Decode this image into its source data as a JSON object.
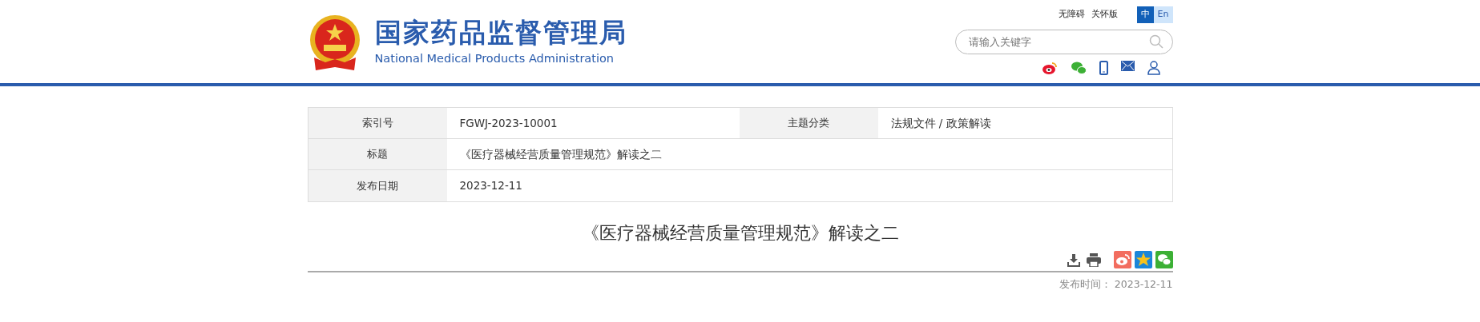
{
  "header": {
    "title": "国家药品监督管理局",
    "subtitle": "National Medical Products Administration",
    "links": [
      "无障碍",
      "关怀版"
    ],
    "languages": [
      {
        "label": "中",
        "selected": true
      },
      {
        "label": "En",
        "selected": false
      }
    ],
    "search": {
      "placeholder": "请输入关键字"
    },
    "share_icons": [
      {
        "kind": "weibo"
      },
      {
        "kind": "wechat"
      },
      {
        "kind": "phone"
      },
      {
        "kind": "mail"
      },
      {
        "kind": "user"
      }
    ]
  },
  "info_table": {
    "rows": [
      {
        "cells": [
          {
            "label": "索引号",
            "value": "FGWJ-2023-10001"
          },
          {
            "label": "主题分类",
            "value": "法规文件 / 政策解读"
          }
        ]
      },
      {
        "cells": [
          {
            "label": "标题",
            "value": "《医疗器械经营质量管理规范》解读之二"
          }
        ]
      },
      {
        "cells": [
          {
            "label": "发布日期",
            "value": "2023-12-11"
          }
        ]
      }
    ]
  },
  "article": {
    "title": "《医疗器械经营质量管理规范》解读之二",
    "tools": [
      {
        "kind": "download"
      },
      {
        "kind": "print"
      }
    ],
    "share": [
      {
        "kind": "weibo"
      },
      {
        "kind": "qzone"
      },
      {
        "kind": "wechat"
      }
    ],
    "date_label": "发布时间：",
    "date": "2023-12-11"
  }
}
